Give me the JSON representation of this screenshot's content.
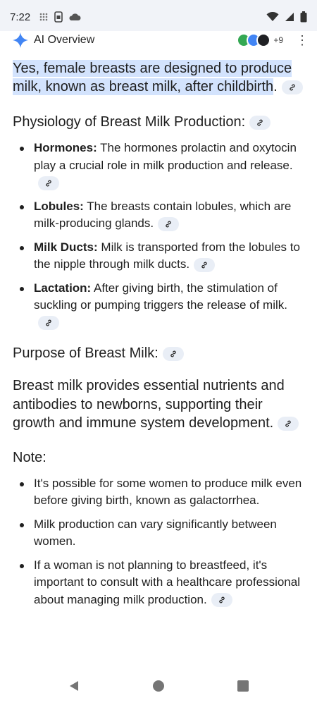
{
  "status_bar": {
    "time": "7:22"
  },
  "header": {
    "title": "AI Overview",
    "avatar_count": "+9",
    "colors": {
      "gemini_star": "#4285f4"
    }
  },
  "answer": {
    "highlighted": "Yes, female breasts are designed to produce milk, known as breast milk, after childbirth",
    "trailing": "."
  },
  "physiology": {
    "title": "Physiology of Breast Milk Production:",
    "items": [
      {
        "term": "Hormones:",
        "text": " The hormones prolactin and oxytocin play a crucial role in milk production and release."
      },
      {
        "term": "Lobules:",
        "text": " The breasts contain lobules, which are milk-producing glands."
      },
      {
        "term": "Milk Ducts:",
        "text": " Milk is transported from the lobules to the nipple through milk ducts."
      },
      {
        "term": "Lactation:",
        "text": " After giving birth, the stimulation of suckling or pumping triggers the release of milk."
      }
    ]
  },
  "purpose": {
    "title": "Purpose of Breast Milk:",
    "text": "Breast milk provides essential nutrients and antibodies to newborns, supporting their growth and immune system development."
  },
  "note": {
    "title": "Note:",
    "items": [
      "It's possible for some women to produce milk even before giving birth, known as galactorrhea.",
      "Milk production can vary significantly between women.",
      "If a woman is not planning to breastfeed, it's important to consult with a healthcare professional about managing milk production."
    ]
  },
  "icons": {
    "link": "link-icon",
    "back": "back-triangle-icon",
    "home": "home-circle-icon",
    "recents": "recents-square-icon"
  }
}
